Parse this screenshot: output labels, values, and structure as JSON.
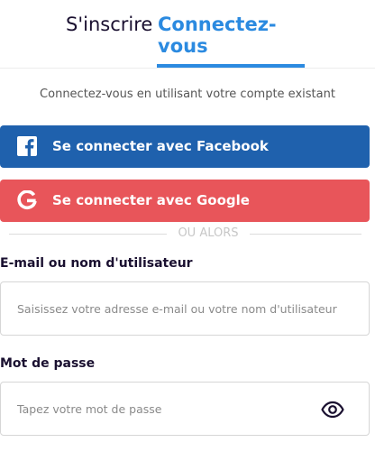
{
  "tabs": {
    "signup_label": "S'inscrire",
    "login_label": "Connectez-vous",
    "active": "login"
  },
  "subtitle": "Connectez-vous en utilisant votre compte existant",
  "social": {
    "facebook_label": "Se connecter avec Facebook",
    "google_label": "Se connecter avec Google",
    "facebook_icon": "facebook-icon",
    "google_icon": "google-icon"
  },
  "divider_text": "OU ALORS",
  "email": {
    "label": "E-mail ou nom d'utilisateur",
    "placeholder": "Saisissez votre adresse e-mail ou votre nom d'utilisateur",
    "value": ""
  },
  "password": {
    "label": "Mot de passe",
    "placeholder": "Tapez votre mot de passe",
    "value": "",
    "toggle_icon": "eye-icon"
  },
  "colors": {
    "accent": "#2b8ae0",
    "facebook": "#1f61ad",
    "google": "#e8555a",
    "text": "#1a1030"
  }
}
